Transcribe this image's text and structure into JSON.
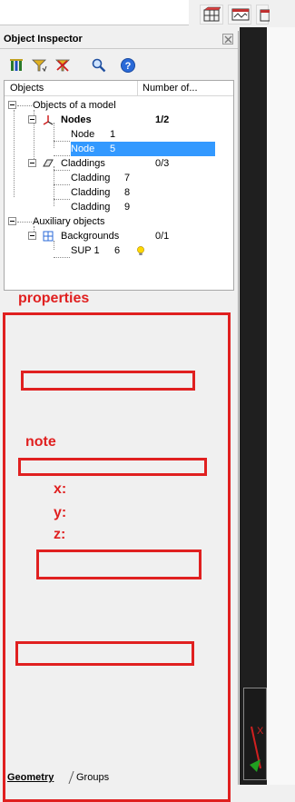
{
  "panel": {
    "title": "Object Inspector"
  },
  "tree": {
    "columns": {
      "objects": "Objects",
      "number": "Number of..."
    },
    "rows": [
      {
        "label": "Objects of a model",
        "num": "",
        "count": ""
      },
      {
        "label": "Nodes",
        "num": "",
        "count": "1/2"
      },
      {
        "label": "Node",
        "num": "1",
        "count": ""
      },
      {
        "label": "Node",
        "num": "5",
        "count": ""
      },
      {
        "label": "Claddings",
        "num": "",
        "count": "0/3"
      },
      {
        "label": "Cladding",
        "num": "7",
        "count": ""
      },
      {
        "label": "Cladding",
        "num": "8",
        "count": ""
      },
      {
        "label": "Cladding",
        "num": "9",
        "count": ""
      },
      {
        "label": "Auxiliary objects",
        "num": "",
        "count": ""
      },
      {
        "label": "Backgrounds",
        "num": "",
        "count": "0/1"
      },
      {
        "label": "SUP 1",
        "num": "6",
        "count": ""
      }
    ],
    "selected_row": "Node 5"
  },
  "annotations": {
    "properties": "properties",
    "note": "note",
    "x": "x:",
    "y": "y:",
    "z": "z:"
  },
  "tabs": {
    "geometry": "Geometry",
    "groups": "Groups"
  },
  "colors": {
    "selection": "#3399ff",
    "annotation_red": "#e02020",
    "viewport_dark": "#1f1f1f"
  }
}
